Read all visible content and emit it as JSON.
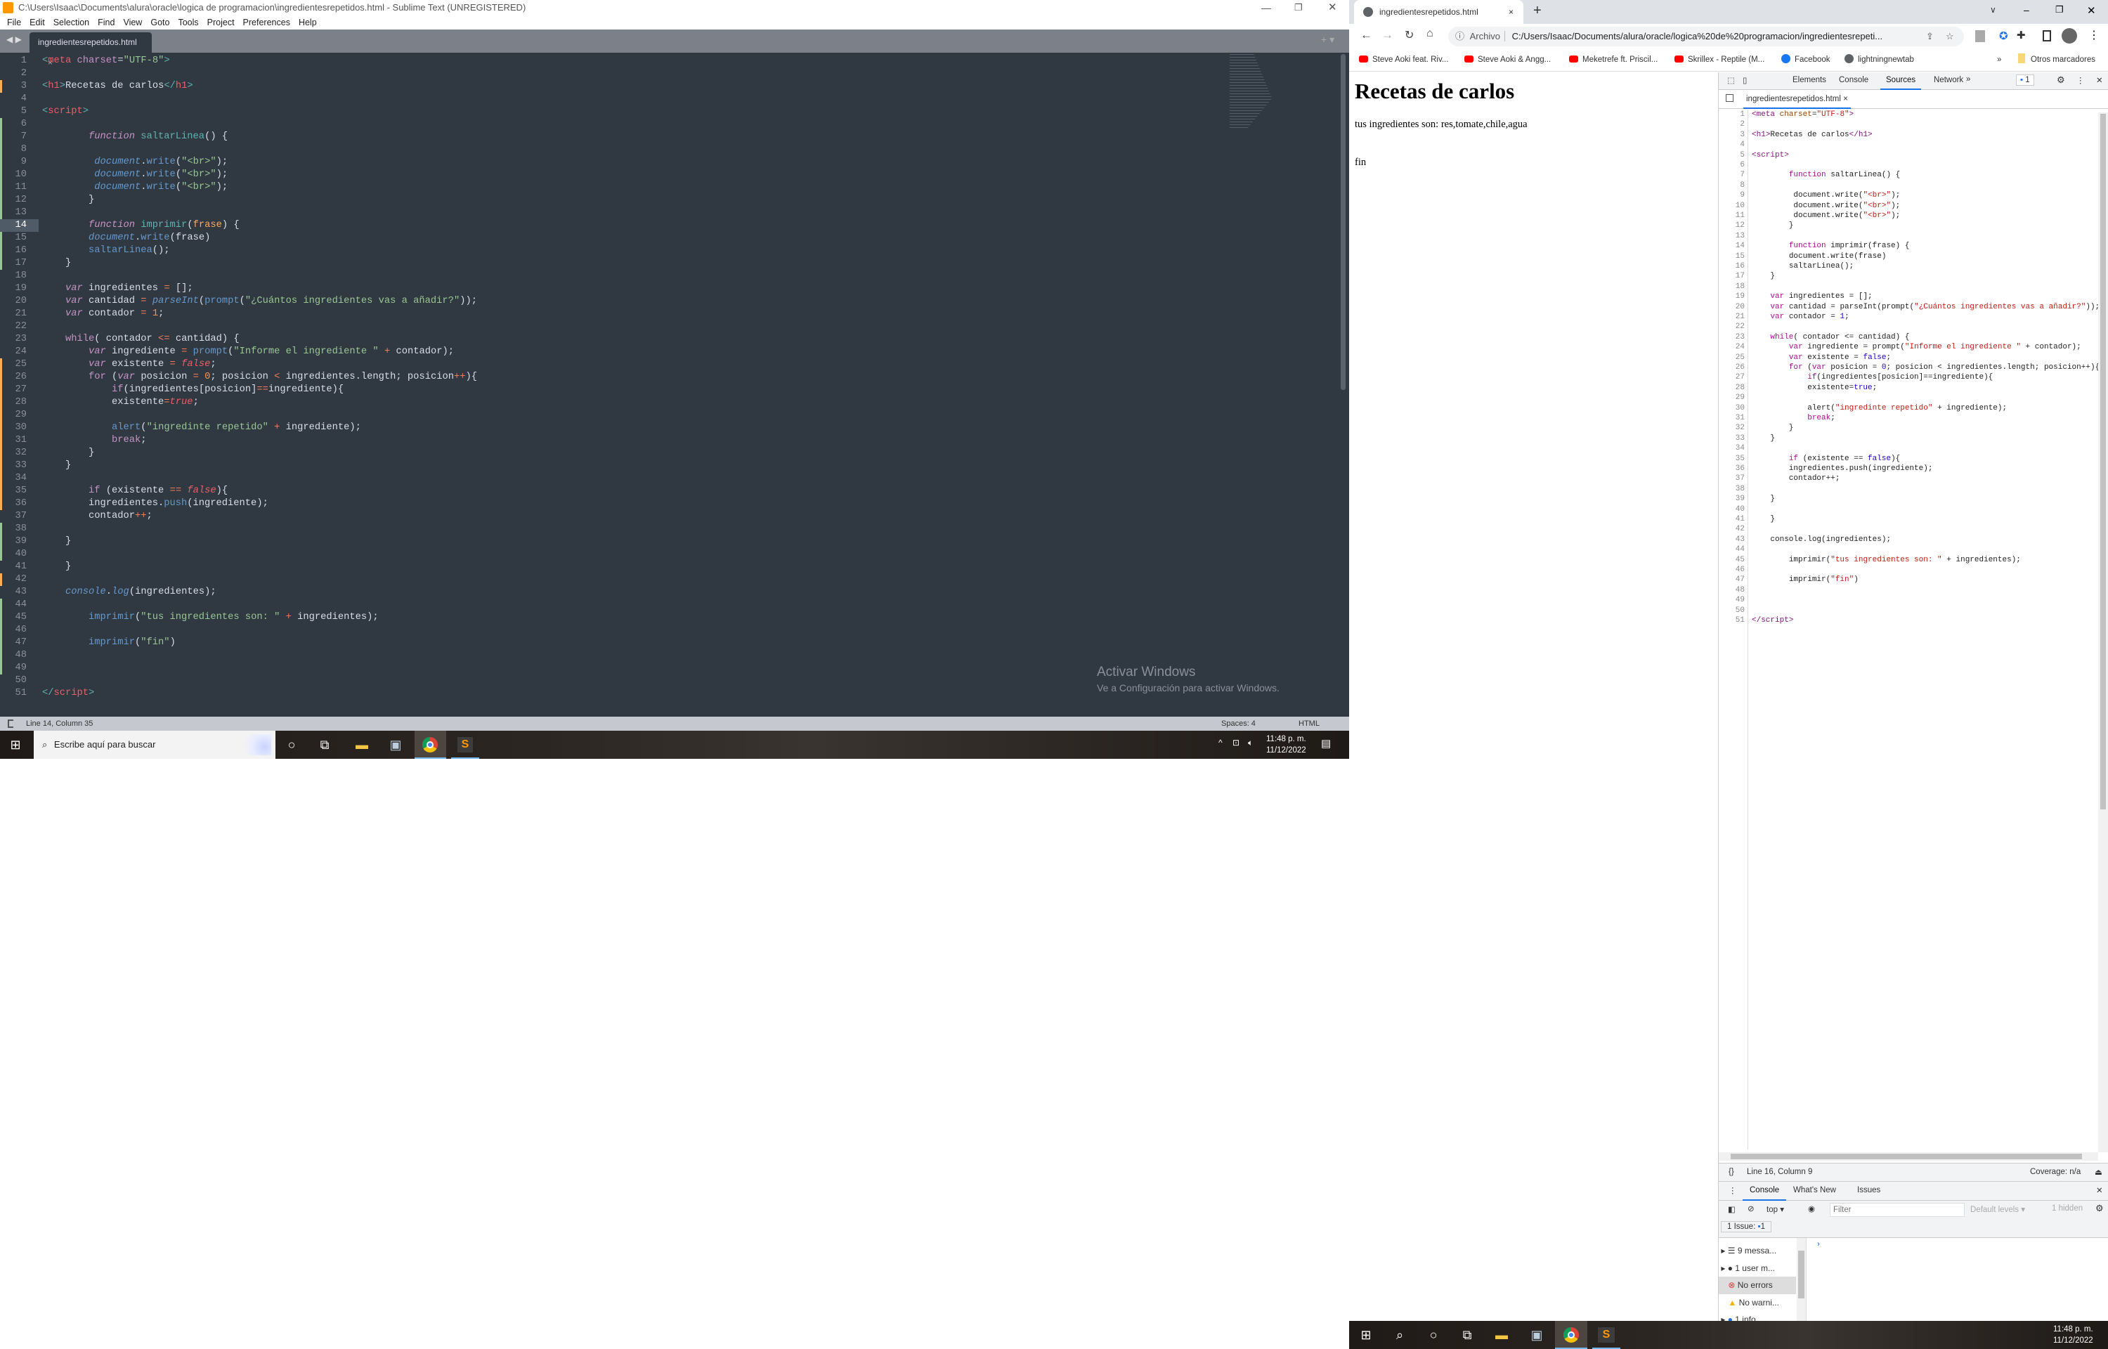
{
  "sublime": {
    "title": "C:\\Users\\Isaac\\Documents\\alura\\oracle\\logica de programacion\\ingredientesrepetidos.html - Sublime Text (UNREGISTERED)",
    "menu": [
      "File",
      "Edit",
      "Selection",
      "Find",
      "View",
      "Goto",
      "Tools",
      "Project",
      "Preferences",
      "Help"
    ],
    "tab": "ingredientesrepetidos.html",
    "current_line": 14,
    "gutter_modified": [
      3,
      25,
      26,
      27,
      28,
      29,
      30,
      31,
      32,
      33,
      34,
      35,
      36,
      42
    ],
    "gutter_added": [
      6,
      7,
      8,
      9,
      10,
      11,
      12,
      13,
      14,
      15,
      16,
      17,
      38,
      39,
      40,
      44,
      45,
      46,
      47,
      48,
      49
    ],
    "status": {
      "position": "Line 14, Column 35",
      "spaces": "Spaces: 4",
      "syntax": "HTML"
    },
    "watermark": [
      "Activar Windows",
      "Ve a Configuración para activar Windows."
    ]
  },
  "code": {
    "lines": [
      [
        [
          "<",
          "br"
        ],
        [
          "meta",
          "tag"
        ],
        [
          " ",
          "p"
        ],
        [
          "charset",
          "attr"
        ],
        [
          "=",
          "p"
        ],
        [
          "\"UTF-8\"",
          "str"
        ],
        [
          ">",
          "br"
        ]
      ],
      [],
      [
        [
          "<",
          "br"
        ],
        [
          "h1",
          "tag"
        ],
        [
          ">",
          "br"
        ],
        [
          "Recetas de carlos",
          "p"
        ],
        [
          "</",
          "br"
        ],
        [
          "h1",
          "tag"
        ],
        [
          ">",
          "br"
        ]
      ],
      [],
      [
        [
          "<",
          "br"
        ],
        [
          "script",
          "tag"
        ],
        [
          ">",
          "br"
        ]
      ],
      [],
      [
        [
          "        ",
          "p"
        ],
        [
          "function",
          "kw"
        ],
        [
          " ",
          "p"
        ],
        [
          "saltarLinea",
          "fnd"
        ],
        [
          "() {",
          "p"
        ]
      ],
      [],
      [
        [
          "         ",
          "p"
        ],
        [
          "document",
          "obj"
        ],
        [
          ".",
          "p"
        ],
        [
          "write",
          "fn"
        ],
        [
          "(",
          "p"
        ],
        [
          "\"<br>\"",
          "str"
        ],
        [
          ");",
          "p"
        ]
      ],
      [
        [
          "         ",
          "p"
        ],
        [
          "document",
          "obj"
        ],
        [
          ".",
          "p"
        ],
        [
          "write",
          "fn"
        ],
        [
          "(",
          "p"
        ],
        [
          "\"<br>\"",
          "str"
        ],
        [
          ");",
          "p"
        ]
      ],
      [
        [
          "         ",
          "p"
        ],
        [
          "document",
          "obj"
        ],
        [
          ".",
          "p"
        ],
        [
          "write",
          "fn"
        ],
        [
          "(",
          "p"
        ],
        [
          "\"<br>\"",
          "str"
        ],
        [
          ");",
          "p"
        ]
      ],
      [
        [
          "        }",
          "p"
        ]
      ],
      [],
      [
        [
          "        ",
          "p"
        ],
        [
          "function",
          "kw"
        ],
        [
          " ",
          "p"
        ],
        [
          "imprimir",
          "fnd"
        ],
        [
          "(",
          "p"
        ],
        [
          "frase",
          "param"
        ],
        [
          ") {",
          "p"
        ]
      ],
      [
        [
          "        ",
          "p"
        ],
        [
          "document",
          "obj"
        ],
        [
          ".",
          "p"
        ],
        [
          "write",
          "fn"
        ],
        [
          "(frase)",
          "p"
        ]
      ],
      [
        [
          "        ",
          "p"
        ],
        [
          "saltarLinea",
          "fn"
        ],
        [
          "();",
          "p"
        ]
      ],
      [
        [
          "    }",
          "p"
        ]
      ],
      [],
      [
        [
          "    ",
          "p"
        ],
        [
          "var",
          "kw"
        ],
        [
          " ingredientes ",
          "p"
        ],
        [
          "=",
          "op"
        ],
        [
          " [];",
          "p"
        ]
      ],
      [
        [
          "    ",
          "p"
        ],
        [
          "var",
          "kw"
        ],
        [
          " cantidad ",
          "p"
        ],
        [
          "=",
          "op"
        ],
        [
          " ",
          "p"
        ],
        [
          "parseInt",
          "fni"
        ],
        [
          "(",
          "p"
        ],
        [
          "prompt",
          "fn"
        ],
        [
          "(",
          "p"
        ],
        [
          "\"¿Cuántos ingredientes vas a añadir?\"",
          "str"
        ],
        [
          "));",
          "p"
        ]
      ],
      [
        [
          "    ",
          "p"
        ],
        [
          "var",
          "kw"
        ],
        [
          " contador ",
          "p"
        ],
        [
          "=",
          "op"
        ],
        [
          " ",
          "p"
        ],
        [
          "1",
          "num"
        ],
        [
          ";",
          "p"
        ]
      ],
      [],
      [
        [
          "    ",
          "p"
        ],
        [
          "while",
          "ctl"
        ],
        [
          "( contador ",
          "p"
        ],
        [
          "<=",
          "op"
        ],
        [
          " cantidad) {",
          "p"
        ]
      ],
      [
        [
          "        ",
          "p"
        ],
        [
          "var",
          "kw"
        ],
        [
          " ingrediente ",
          "p"
        ],
        [
          "=",
          "op"
        ],
        [
          " ",
          "p"
        ],
        [
          "prompt",
          "fn"
        ],
        [
          "(",
          "p"
        ],
        [
          "\"Informe el ingrediente \"",
          "str"
        ],
        [
          " ",
          "p"
        ],
        [
          "+",
          "op"
        ],
        [
          " contador);",
          "p"
        ]
      ],
      [
        [
          "        ",
          "p"
        ],
        [
          "var",
          "kw"
        ],
        [
          " existente ",
          "p"
        ],
        [
          "=",
          "op"
        ],
        [
          " ",
          "p"
        ],
        [
          "false",
          "bool"
        ],
        [
          ";",
          "p"
        ]
      ],
      [
        [
          "        ",
          "p"
        ],
        [
          "for",
          "ctl"
        ],
        [
          " (",
          "p"
        ],
        [
          "var",
          "kw"
        ],
        [
          " posicion ",
          "p"
        ],
        [
          "=",
          "op"
        ],
        [
          " ",
          "p"
        ],
        [
          "0",
          "num"
        ],
        [
          "; posicion ",
          "p"
        ],
        [
          "<",
          "op"
        ],
        [
          " ingredientes.length; posicion",
          "p"
        ],
        [
          "++",
          "op"
        ],
        [
          "){",
          "p"
        ]
      ],
      [
        [
          "            ",
          "p"
        ],
        [
          "if",
          "ctl"
        ],
        [
          "(ingredientes[posicion]",
          "p"
        ],
        [
          "==",
          "op"
        ],
        [
          "ingrediente){",
          "p"
        ]
      ],
      [
        [
          "            existente",
          "p"
        ],
        [
          "=",
          "op"
        ],
        [
          "true",
          "bool"
        ],
        [
          ";",
          "p"
        ]
      ],
      [],
      [
        [
          "            ",
          "p"
        ],
        [
          "alert",
          "fn"
        ],
        [
          "(",
          "p"
        ],
        [
          "\"ingredinte repetido\"",
          "str"
        ],
        [
          " ",
          "p"
        ],
        [
          "+",
          "op"
        ],
        [
          " ingrediente);",
          "p"
        ]
      ],
      [
        [
          "            ",
          "p"
        ],
        [
          "break",
          "ctl"
        ],
        [
          ";",
          "p"
        ]
      ],
      [
        [
          "        }",
          "p"
        ]
      ],
      [
        [
          "    }",
          "p"
        ]
      ],
      [],
      [
        [
          "        ",
          "p"
        ],
        [
          "if",
          "ctl"
        ],
        [
          " (existente ",
          "p"
        ],
        [
          "==",
          "op"
        ],
        [
          " ",
          "p"
        ],
        [
          "false",
          "bool"
        ],
        [
          "){",
          "p"
        ]
      ],
      [
        [
          "        ingredientes.",
          "p"
        ],
        [
          "push",
          "fn"
        ],
        [
          "(ingrediente);",
          "p"
        ]
      ],
      [
        [
          "        contador",
          "p"
        ],
        [
          "++",
          "op"
        ],
        [
          ";",
          "p"
        ]
      ],
      [],
      [
        [
          "    }",
          "p"
        ]
      ],
      [],
      [
        [
          "    }",
          "p"
        ]
      ],
      [],
      [
        [
          "    ",
          "p"
        ],
        [
          "console",
          "obj"
        ],
        [
          ".",
          "p"
        ],
        [
          "log",
          "obj"
        ],
        [
          "(ingredientes);",
          "p"
        ]
      ],
      [],
      [
        [
          "        ",
          "p"
        ],
        [
          "imprimir",
          "fn"
        ],
        [
          "(",
          "p"
        ],
        [
          "\"tus ingredientes son: \"",
          "str"
        ],
        [
          " ",
          "p"
        ],
        [
          "+",
          "op"
        ],
        [
          " ingredientes);",
          "p"
        ]
      ],
      [],
      [
        [
          "        ",
          "p"
        ],
        [
          "imprimir",
          "fn"
        ],
        [
          "(",
          "p"
        ],
        [
          "\"fin\"",
          "str"
        ],
        [
          ")",
          "p"
        ]
      ],
      [],
      [],
      [],
      [
        [
          "</",
          "br"
        ],
        [
          "script",
          "tag"
        ],
        [
          ">",
          "br"
        ]
      ]
    ]
  },
  "taskbar_left": {
    "search_placeholder": "Escribe aquí para buscar",
    "time": "11:48 p. m.",
    "date": "11/12/2022"
  },
  "taskbar_right": {
    "time": "11:48 p. m.",
    "date": "11/12/2022"
  },
  "chrome": {
    "tab_title": "ingredientesrepetidos.html",
    "address_label": "Archivo",
    "url": "C:/Users/Isaac/Documents/alura/oracle/logica%20de%20programacion/ingredientesrepeti...",
    "bookmarks": [
      "Steve Aoki feat. Riv...",
      "Steve Aoki & Angg...",
      "Meketrefe ft. Priscil...",
      "Skrillex - Reptile (M...",
      "Facebook",
      "lightningnewtab"
    ],
    "other_bookmarks": "Otros marcadores",
    "page": {
      "h1": "Recetas de carlos",
      "line1": "tus ingredientes son: res,tomate,chile,agua",
      "line2": "fin"
    },
    "devtools": {
      "tabs": [
        "Elements",
        "Console",
        "Sources",
        "Network"
      ],
      "active_tab": "Sources",
      "issues_badge": "1",
      "file_tab": "ingredientesrepetidos.html",
      "status_position": "Line 16, Column 9",
      "coverage": "Coverage: n/a",
      "drawer_tabs": [
        "Console",
        "What's New",
        "Issues"
      ],
      "context": "top",
      "filter_placeholder": "Filter",
      "levels": "Default levels",
      "hidden": "1 hidden",
      "issue_label": "1 Issue:",
      "issue_count": "1",
      "sidebar": [
        "9 messa...",
        "1 user m...",
        "No errors",
        "No warni...",
        "1 info"
      ]
    }
  }
}
